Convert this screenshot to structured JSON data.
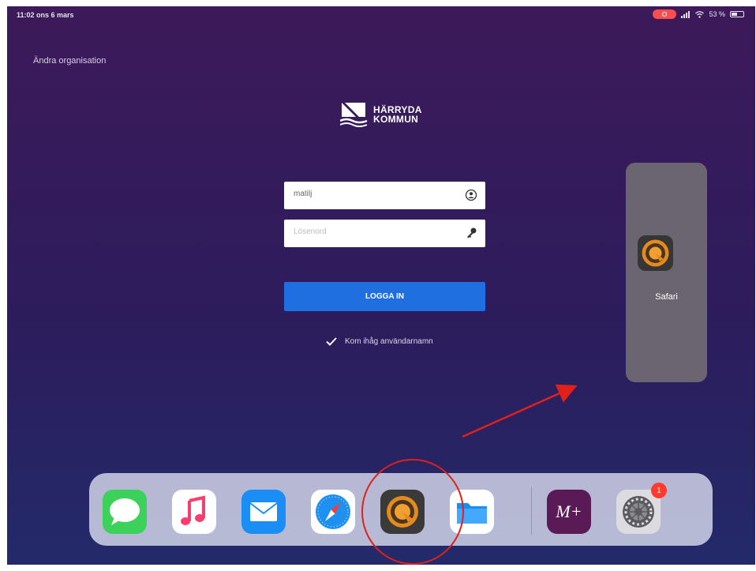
{
  "status_bar": {
    "time_date": "11:02  ons 6 mars",
    "battery": "53 %",
    "battery_level": 0.53
  },
  "header": {
    "change_org_label": "Ändra organisation"
  },
  "logo": {
    "line1": "HÄRRYDA",
    "line2": "KOMMUN"
  },
  "login": {
    "username_value": "matilj",
    "password_placeholder": "Lösenord",
    "login_button": "LOGGA IN",
    "remember_label": "Kom ihåg användarnamn"
  },
  "slide_over": {
    "app_label": "Safari"
  },
  "dock": {
    "apps": [
      {
        "name": "Messages",
        "icon": "messages-icon"
      },
      {
        "name": "Music",
        "icon": "music-icon"
      },
      {
        "name": "Mail",
        "icon": "mail-icon"
      },
      {
        "name": "Safari",
        "icon": "safari-icon"
      },
      {
        "name": "App",
        "icon": "app-q-icon"
      },
      {
        "name": "Files",
        "icon": "files-icon"
      },
      {
        "name": "M+",
        "icon": "m-plus-icon"
      },
      {
        "name": "Settings",
        "icon": "settings-icon"
      }
    ],
    "m_plus_text": "M+",
    "settings_badge": "1"
  },
  "colors": {
    "background_top": "#3d1a5a",
    "background_bottom": "#232a6a",
    "login_button": "#1f6fe0",
    "annotation": "#e0201b"
  }
}
